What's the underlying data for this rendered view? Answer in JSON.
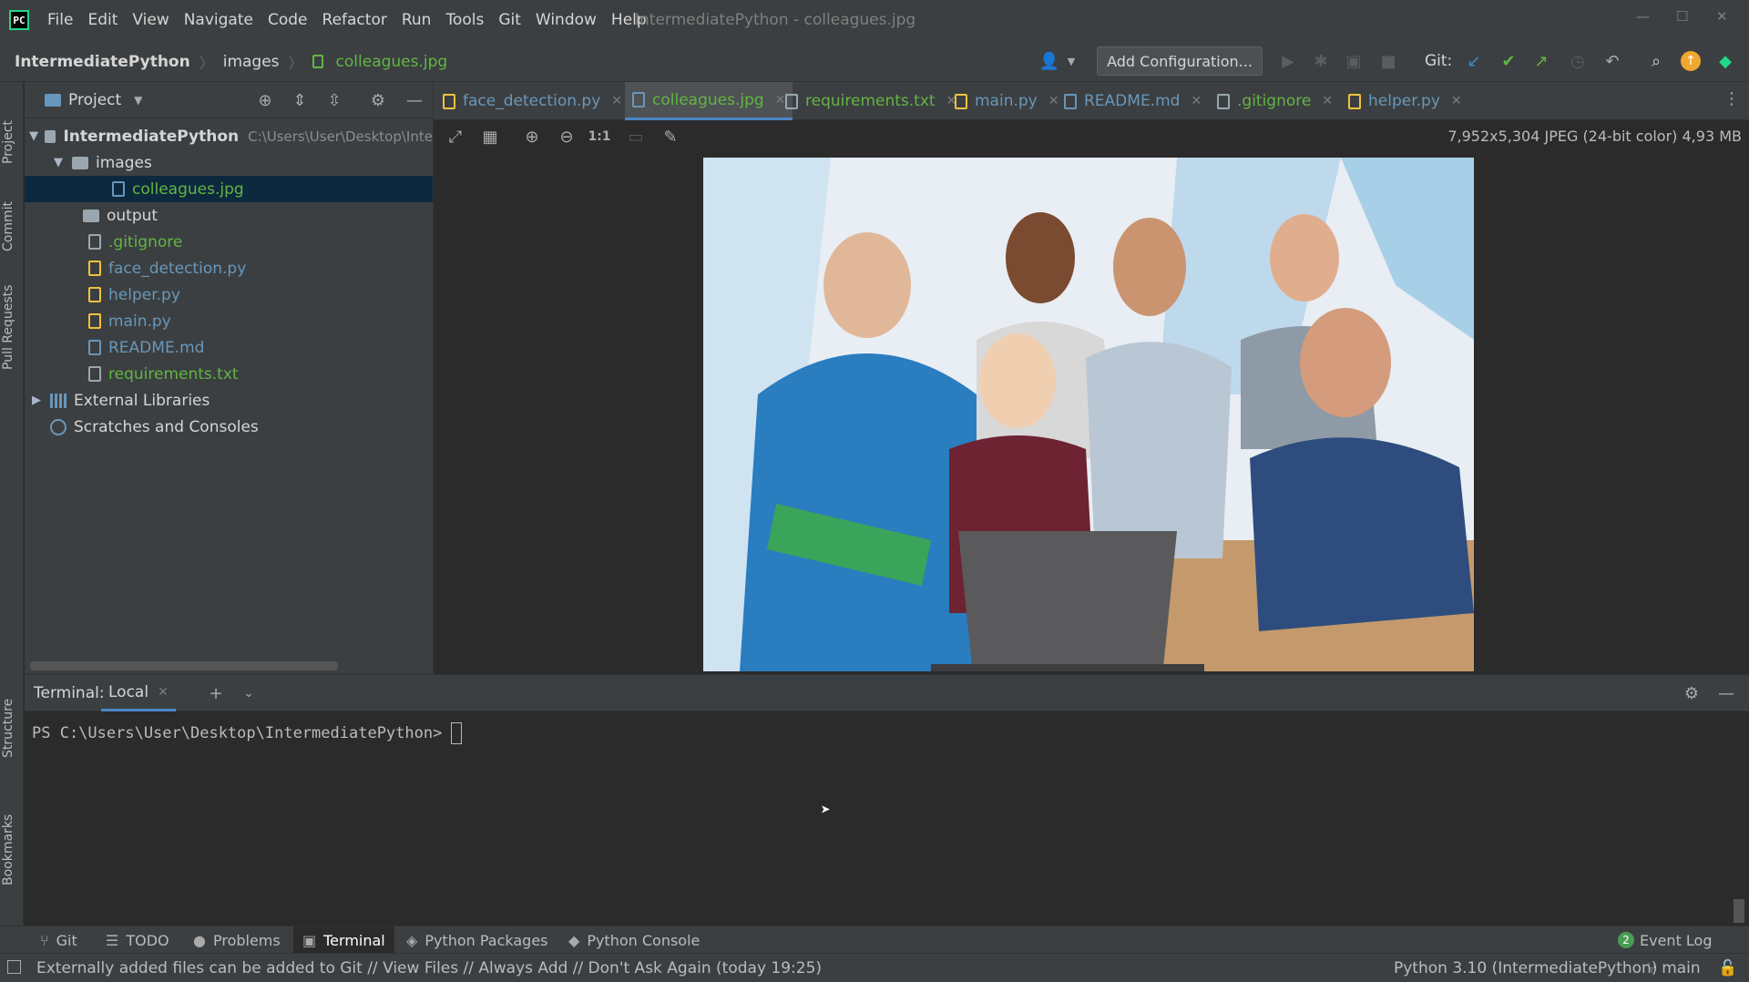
{
  "menu": {
    "items": [
      "File",
      "Edit",
      "View",
      "Navigate",
      "Code",
      "Refactor",
      "Run",
      "Tools",
      "Git",
      "Window",
      "Help"
    ],
    "window_title": "IntermediatePython - colleagues.jpg"
  },
  "breadcrumbs": [
    "IntermediatePython",
    "images",
    "colleagues.jpg"
  ],
  "toolbar": {
    "add_config": "Add Configuration...",
    "git_label": "Git:"
  },
  "project": {
    "title": "Project",
    "root": {
      "label": "IntermediatePython",
      "path": "C:\\Users\\User\\Desktop\\Inte"
    },
    "items": [
      {
        "label": "images"
      },
      {
        "label": "colleagues.jpg"
      },
      {
        "label": "output"
      },
      {
        "label": ".gitignore"
      },
      {
        "label": "face_detection.py"
      },
      {
        "label": "helper.py"
      },
      {
        "label": "main.py"
      },
      {
        "label": "README.md"
      },
      {
        "label": "requirements.txt"
      },
      {
        "label": "External Libraries"
      },
      {
        "label": "Scratches and Consoles"
      }
    ]
  },
  "tabs": [
    {
      "label": "face_detection.py",
      "color": "#6897bb"
    },
    {
      "label": "colleagues.jpg",
      "color": "#62b543"
    },
    {
      "label": "requirements.txt",
      "color": "#62b543"
    },
    {
      "label": "main.py",
      "color": "#6897bb"
    },
    {
      "label": "README.md",
      "color": "#6897bb"
    },
    {
      "label": ".gitignore",
      "color": "#62b543"
    },
    {
      "label": "helper.py",
      "color": "#6897bb"
    }
  ],
  "image_info": "7,952x5,304 JPEG (24-bit color) 4,93 MB",
  "terminal": {
    "title": "Terminal:",
    "tab": "Local",
    "prompt": "PS C:\\Users\\User\\Desktop\\IntermediatePython>"
  },
  "leftstrip": {
    "project": "Project",
    "commit": "Commit",
    "pull": "Pull Requests",
    "structure": "Structure",
    "bookmarks": "Bookmarks"
  },
  "bottom_tools": {
    "items": [
      "Git",
      "TODO",
      "Problems",
      "Terminal",
      "Python Packages",
      "Python Console"
    ],
    "event_log": "Event Log",
    "event_count": "2"
  },
  "status": {
    "message": "Externally added files can be added to Git // View Files // Always Add // Don't Ask Again (today 19:25)",
    "interpreter": "Python 3.10 (IntermediatePython)",
    "branch": "main"
  },
  "colors": {
    "accent": "#4a88c7",
    "green": "#62b543",
    "selection": "#0d293e"
  }
}
